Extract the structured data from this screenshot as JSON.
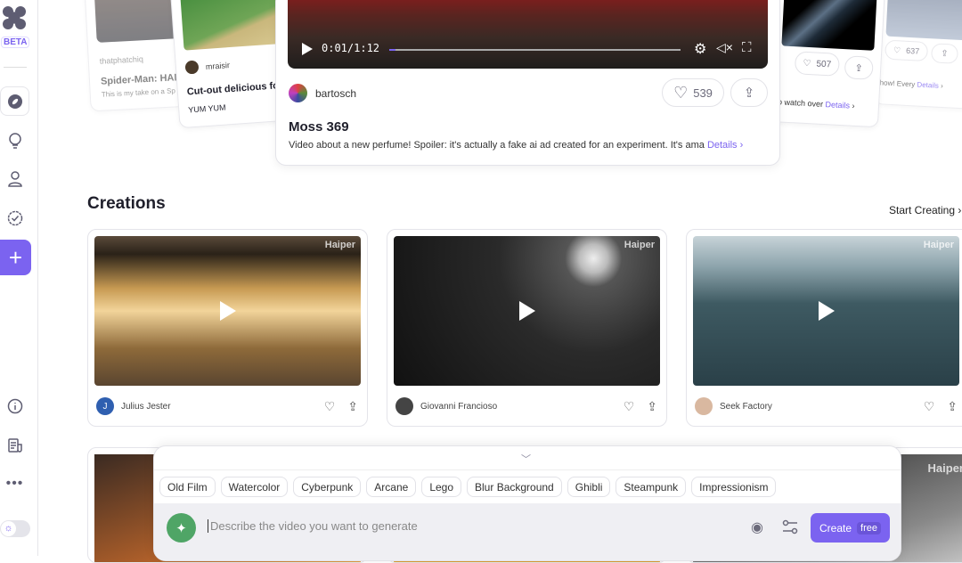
{
  "sidebar": {
    "beta": "BETA",
    "items": [
      "explore-icon",
      "lightbulb-icon",
      "profile-icon",
      "verified-icon",
      "plus-icon",
      "info-icon",
      "news-icon",
      "more-icon"
    ]
  },
  "featured": {
    "left_cards": [
      {
        "author": "thatphatchiq",
        "title": "Spider-Man: HAIP",
        "desc": "This is my take on a Sp"
      },
      {
        "author": "mraisir",
        "title": "Cut-out delicious foo",
        "desc": "YUM YUM"
      }
    ],
    "right_cards": [
      {
        "likes": "507",
        "desc": "re to watch over",
        "details": "Details"
      },
      {
        "likes": "637",
        "desc": "show! Every",
        "details": "Details"
      }
    ],
    "main": {
      "time": "0:01/1:12",
      "progress": 0.02,
      "author": "bartosch",
      "likes": "539",
      "title": "Moss 369",
      "desc": "Video about a new perfume! Spoiler: it's actually a fake ai ad created for an experiment. It's ama",
      "details": "Details"
    }
  },
  "creations": {
    "title": "Creations",
    "start": "Start Creating",
    "watermark": "Haiper",
    "cards": [
      {
        "author": "Julius Jester",
        "initial": "J"
      },
      {
        "author": "Giovanni Francioso"
      },
      {
        "author": "Seek Factory"
      }
    ]
  },
  "prompt": {
    "styles": [
      "Old Film",
      "Watercolor",
      "Cyberpunk",
      "Arcane",
      "Lego",
      "Blur Background",
      "Ghibli",
      "Steampunk",
      "Impressionism"
    ],
    "placeholder": "Describe the video you want to generate",
    "create": "Create",
    "free": "free"
  },
  "colors": {
    "accent": "#7b63f0",
    "green": "#4fa566"
  }
}
